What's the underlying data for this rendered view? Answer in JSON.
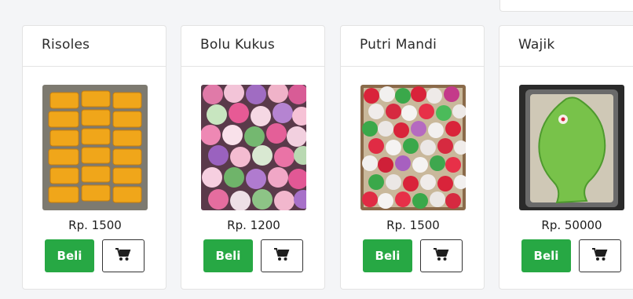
{
  "products": [
    {
      "name": "Risoles",
      "price": "Rp. 1500",
      "image_icon": "risoles-photo",
      "buy_label": "Beli",
      "cart_icon": "cart-icon"
    },
    {
      "name": "Bolu Kukus",
      "price": "Rp. 1200",
      "image_icon": "bolu-kukus-photo",
      "buy_label": "Beli",
      "cart_icon": "cart-icon"
    },
    {
      "name": "Putri Mandi",
      "price": "Rp. 1500",
      "image_icon": "putri-mandi-photo",
      "buy_label": "Beli",
      "cart_icon": "cart-icon"
    },
    {
      "name": "Wajik",
      "price": "Rp. 50000",
      "image_icon": "wajik-photo",
      "buy_label": "Beli",
      "cart_icon": "cart-icon"
    }
  ],
  "colors": {
    "buy_button": "#27a844",
    "background": "#f4f5f7",
    "card": "#ffffff"
  }
}
